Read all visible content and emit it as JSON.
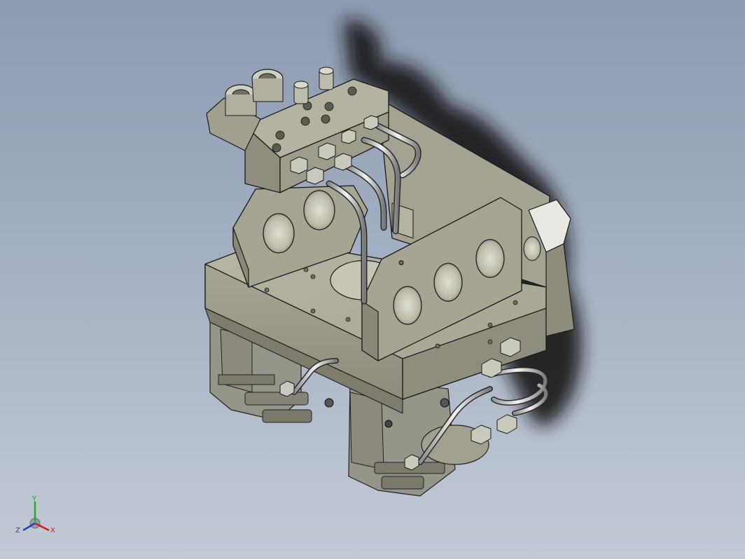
{
  "viewport": {
    "background_top": "#8d9ab0",
    "background_bottom": "#c3cad6",
    "model_color": "#a9a896",
    "model_shade": "#7f7e6e",
    "edge_color": "#1a1a1a",
    "shadow_color": "#151515"
  },
  "triad": {
    "x_label": "X",
    "y_label": "Y",
    "z_label": "Z",
    "x_color": "#d41c1c",
    "y_color": "#1fae2c",
    "z_color": "#2140c8"
  }
}
